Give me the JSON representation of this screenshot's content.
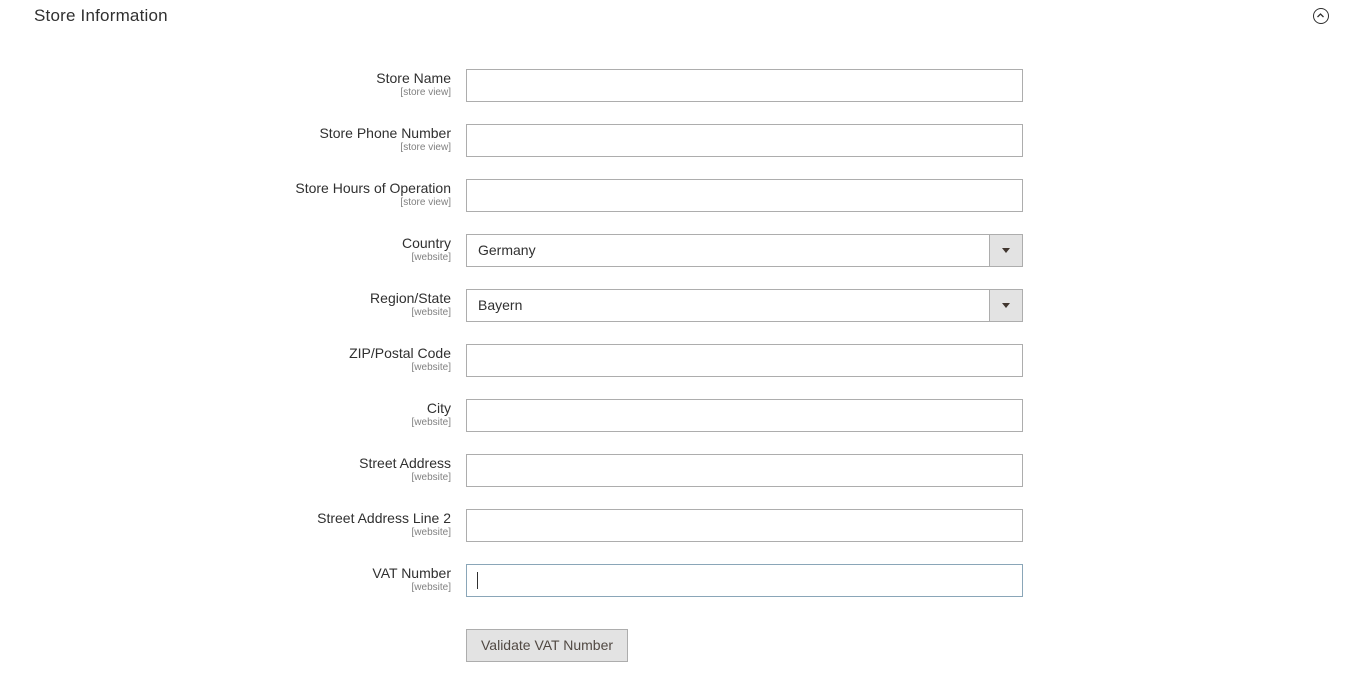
{
  "section": {
    "title": "Store Information",
    "collapse_icon": "chevron-up-circle-icon"
  },
  "fields": [
    {
      "key": "store_name",
      "label": "Store Name",
      "scope": "[store view]",
      "type": "text",
      "value": ""
    },
    {
      "key": "store_phone",
      "label": "Store Phone Number",
      "scope": "[store view]",
      "type": "text",
      "value": ""
    },
    {
      "key": "store_hours",
      "label": "Store Hours of Operation",
      "scope": "[store view]",
      "type": "text",
      "value": ""
    },
    {
      "key": "country",
      "label": "Country",
      "scope": "[website]",
      "type": "select",
      "value": "Germany"
    },
    {
      "key": "region",
      "label": "Region/State",
      "scope": "[website]",
      "type": "select",
      "value": "Bayern"
    },
    {
      "key": "zip",
      "label": "ZIP/Postal Code",
      "scope": "[website]",
      "type": "text",
      "value": ""
    },
    {
      "key": "city",
      "label": "City",
      "scope": "[website]",
      "type": "text",
      "value": ""
    },
    {
      "key": "street1",
      "label": "Street Address",
      "scope": "[website]",
      "type": "text",
      "value": ""
    },
    {
      "key": "street2",
      "label": "Street Address Line 2",
      "scope": "[website]",
      "type": "text",
      "value": ""
    },
    {
      "key": "vat",
      "label": "VAT Number",
      "scope": "[website]",
      "type": "text",
      "value": ""
    }
  ],
  "validate_button": {
    "label": "Validate VAT Number"
  }
}
